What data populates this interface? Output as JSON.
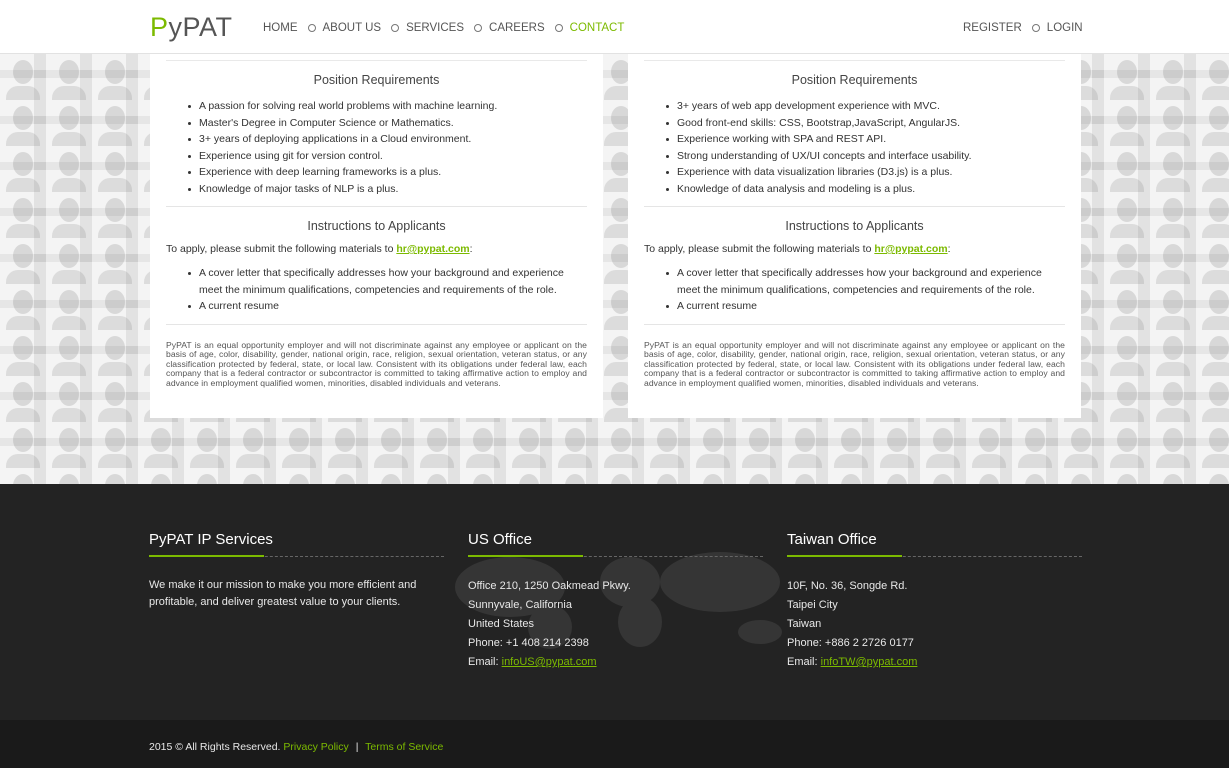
{
  "header": {
    "logo": "PyPAT",
    "nav": [
      {
        "label": "HOME"
      },
      {
        "label": "ABOUT US"
      },
      {
        "label": "SERVICES"
      },
      {
        "label": "CAREERS"
      },
      {
        "label": "CONTACT"
      }
    ],
    "register": "REGISTER",
    "login": "LOGIN"
  },
  "cards": [
    {
      "req_title": "Position Requirements",
      "requirements": [
        "A passion for solving real world problems with machine learning.",
        "Master's Degree in Computer Science or Mathematics.",
        "3+ years of deploying applications in a Cloud environment.",
        "Experience using git for version control.",
        "Experience with deep learning frameworks is a plus.",
        "Knowledge of major tasks of NLP is a plus."
      ],
      "inst_title": "Instructions to Applicants",
      "apply_text": "To apply, please submit the following materials to ",
      "apply_email": "hr@pypat.com",
      "apply_colon": ":",
      "instructions": [
        "A cover letter that specifically addresses how your background and experience meet the minimum qualifications, competencies and requirements of the role.",
        "A current resume"
      ],
      "legal": "PyPAT is an equal opportunity employer and will not discriminate against any employee or applicant on the basis of age, color, disability, gender, national origin, race, religion, sexual orientation, veteran status, or any classification protected by federal, state, or local law. Consistent with its obligations under federal law, each company that is a federal contractor or subcontractor is committed to taking affirmative action to employ and advance in employment qualified women, minorities, disabled individuals and veterans."
    },
    {
      "req_title": "Position Requirements",
      "requirements": [
        "3+ years of web app development experience with MVC.",
        "Good front-end skills: CSS, Bootstrap,JavaScript, AngularJS.",
        "Experience working with SPA and REST API.",
        "Strong understanding of UX/UI concepts and interface usability.",
        "Experience with data visualization libraries (D3.js) is a plus.",
        "Knowledge of data analysis and modeling is a plus."
      ],
      "inst_title": "Instructions to Applicants",
      "apply_text": "To apply, please submit the following materials to ",
      "apply_email": "hr@pypat.com",
      "apply_colon": ":",
      "instructions": [
        "A cover letter that specifically addresses how your background and experience meet the minimum qualifications, competencies and requirements of the role.",
        "A current resume"
      ],
      "legal": "PyPAT is an equal opportunity employer and will not discriminate against any employee or applicant on the basis of age, color, disability, gender, national origin, race, religion, sexual orientation, veteran status, or any classification protected by federal, state, or local law. Consistent with its obligations under federal law, each company that is a federal contractor or subcontractor is committed to taking affirmative action to employ and advance in employment qualified women, minorities, disabled individuals and veterans."
    }
  ],
  "footer": {
    "services": {
      "title": "PyPAT IP Services",
      "text": "We make it our mission to make you more efficient and profitable, and deliver greatest value to your clients."
    },
    "us": {
      "title": "US Office",
      "lines": [
        "Office 210, 1250 Oakmead Pkwy.",
        "Sunnyvale, California",
        "United States",
        "Phone: +1 408 214 2398"
      ],
      "email_label": "Email: ",
      "email": "infoUS@pypat.com"
    },
    "tw": {
      "title": "Taiwan Office",
      "lines": [
        "10F, No. 36, Songde Rd.",
        "Taipei City",
        "Taiwan",
        "Phone: +886 2 2726 0177"
      ],
      "email_label": "Email: ",
      "email": "infoTW@pypat.com"
    },
    "copyright": "2015 © All Rights Reserved.",
    "privacy": "Privacy Policy",
    "separator": "|",
    "terms": "Terms of Service"
  },
  "colors": {
    "accent": "#7cba00",
    "footer_bg": "#232323",
    "bottom_bg": "#1a1a1a"
  }
}
